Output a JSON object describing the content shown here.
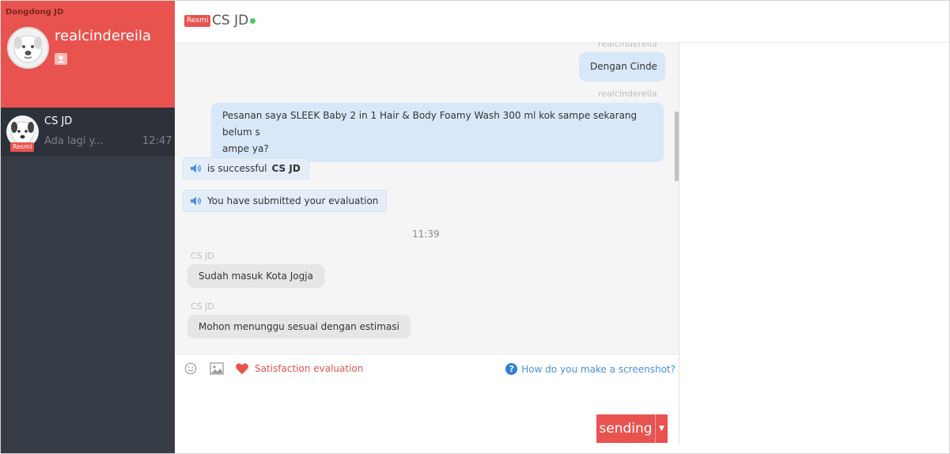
{
  "sidebar": {
    "app_name": "Dongdong JD",
    "username": "realcindereila",
    "conversations": [
      {
        "name": "CS JD",
        "badge": "Resmi",
        "preview": "Ada lagi y...",
        "time": "12:47"
      }
    ]
  },
  "header": {
    "badge": "Resmi",
    "title": "CS JD",
    "status_color": "#4cca5c"
  },
  "messages": {
    "top_partial_sender": "realcindereila",
    "m1_text": "Dengan Cinde",
    "m2_sender": "realcindereila",
    "m2_line1": "Pesanan saya SLEEK Baby 2 in 1 Hair & Body Foamy Wash 300 ml kok sampe sekarang belum s",
    "m2_line2": "ampe ya?",
    "sys1_text": "is successful",
    "sys1_bold": "CS JD",
    "sys2_text": "You have submitted your evaluation",
    "time_divider": "11:39",
    "m3_sender": "CS JD",
    "m3_text": "Sudah masuk Kota Jogja",
    "m4_sender": "CS JD",
    "m4_text": "Mohon menunggu sesuai dengan estimasi"
  },
  "toolbar": {
    "emoji_icon": "smiley-icon",
    "image_icon": "image-icon",
    "satisfaction_label": "Satisfaction evaluation",
    "help_label": "How do you make a screenshot?"
  },
  "send": {
    "label": "sending"
  },
  "colors": {
    "accent": "#e8534f",
    "sidebar_bg": "#363c45",
    "bubble_me": "#d9e8f8",
    "bubble_other": "#e6e6e6",
    "link": "#4a90e2"
  }
}
